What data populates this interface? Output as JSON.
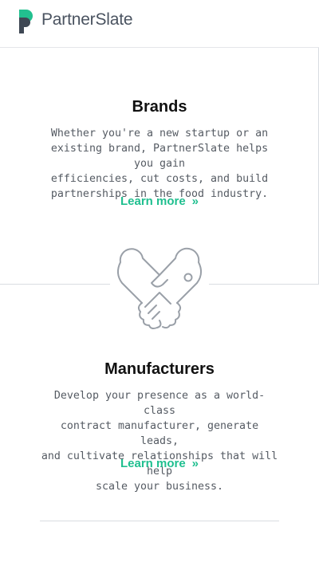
{
  "header": {
    "logo_text": "PartnerSlate"
  },
  "brands": {
    "title": "Brands",
    "description_lines": [
      "Whether you're a new startup or an",
      "existing brand, PartnerSlate helps you gain",
      "efficiencies, cut costs, and build",
      "partnerships in the food industry."
    ],
    "link_label": "Learn more",
    "link_chevron": "»"
  },
  "manufacturers": {
    "title": "Manufacturers",
    "description_lines": [
      "Develop your presence as a world-class",
      "contract manufacturer, generate leads,",
      "and cultivate relationships that will help",
      "scale your business."
    ],
    "link_label": "Learn more",
    "link_chevron": "»"
  },
  "colors": {
    "accent": "#1fbf8f",
    "logo_dark": "#3f4854",
    "text_muted": "#555b63",
    "icon_stroke": "#9aa0a8"
  }
}
